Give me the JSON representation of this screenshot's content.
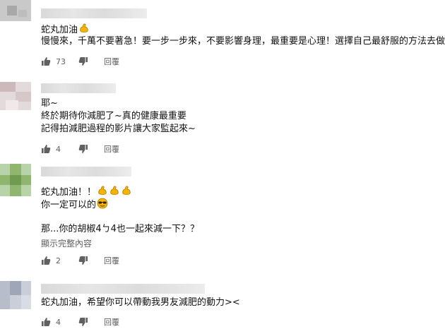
{
  "comments": [
    {
      "lines": [
        "蛇丸加油",
        "慢慢來，千萬不要著急！要一步一步來，不要影響身理，最重要是心理！選擇自己最舒服的方法去做。"
      ],
      "likes": "73",
      "reply_label": "回覆",
      "emoji_line1": [
        "flexed-biceps"
      ]
    },
    {
      "lines": [
        "耶~",
        "終於期待你減肥了~真的健康最重要",
        "記得拍減肥過程的影片讓大家監起來~"
      ],
      "likes": "4",
      "reply_label": "回覆"
    },
    {
      "lines": [
        "蛇丸加油！！",
        "你一定可以的",
        "那...你的胡椒4ㄅ4也一起來減一下？？"
      ],
      "show_more": "顯示完整內容",
      "likes": "2",
      "reply_label": "回覆",
      "emoji_line1": [
        "flexed-biceps",
        "flexed-biceps",
        "flexed-biceps"
      ],
      "emoji_line2": [
        "sunglasses-face"
      ]
    },
    {
      "lines": [
        "蛇丸加油，希望你可以帶動我男友減肥的動力><"
      ],
      "likes": "4",
      "reply_label": "回覆"
    }
  ],
  "colors": {
    "text": "#111111",
    "meta": "#606060",
    "emoji_yellow": "#f4b400"
  },
  "icons": [
    "thumbs-up-icon",
    "thumbs-down-icon",
    "flexed-biceps-emoji",
    "sunglasses-emoji"
  ]
}
